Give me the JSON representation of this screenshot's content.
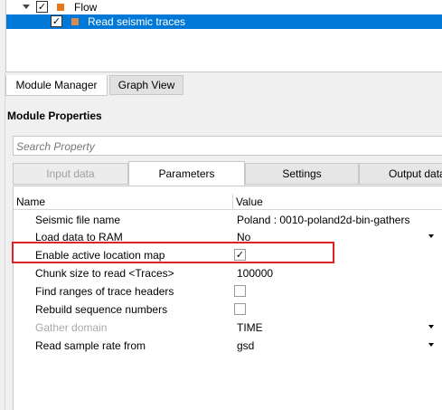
{
  "tree": {
    "flow_label": "Flow",
    "item_label": "Read seismic traces",
    "flow_checked": "✓",
    "item_checked": "✓"
  },
  "bottom_tabs": {
    "module_manager": "Module Manager",
    "graph_view": "Graph View"
  },
  "section_title": "Module Properties",
  "search": {
    "placeholder": "Search Property"
  },
  "tabs": {
    "input_data": "Input data",
    "parameters": "Parameters",
    "settings": "Settings",
    "output_data": "Output data"
  },
  "grid": {
    "header_name": "Name",
    "header_value": "Value",
    "rows": [
      {
        "name": "Seismic file name",
        "value": "Poland : 0010-poland2d-bin-gathers"
      },
      {
        "name": "Load data to RAM",
        "value": "No"
      },
      {
        "name": "Enable active location map",
        "value": "✓"
      },
      {
        "name": "Chunk size to read <Traces>",
        "value": "100000"
      },
      {
        "name": "Find ranges of trace headers",
        "value": ""
      },
      {
        "name": "Rebuild sequence numbers",
        "value": ""
      },
      {
        "name": "Gather domain",
        "value": "TIME"
      },
      {
        "name": "Read sample rate from",
        "value": "gsd"
      }
    ]
  },
  "colors": {
    "selection": "#0078d7",
    "flow_square": "#e8761a",
    "item_square": "#d88a50",
    "highlight": "#e0202a"
  }
}
